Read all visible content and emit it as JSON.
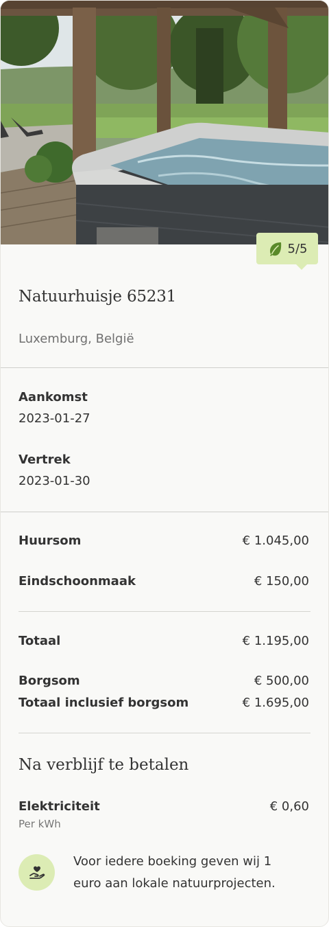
{
  "listing": {
    "eco_score": "5/5",
    "title": "Natuurhuisje 65231",
    "location": "Luxemburg, België"
  },
  "stay": {
    "arrival_label": "Aankomst",
    "arrival_date": "2023-01-27",
    "departure_label": "Vertrek",
    "departure_date": "2023-01-30"
  },
  "costs": {
    "rent_label": "Huursom",
    "rent_amount": "€ 1.045,00",
    "cleaning_label": "Eindschoonmaak",
    "cleaning_amount": "€ 150,00",
    "total_label": "Totaal",
    "total_amount": "€ 1.195,00",
    "deposit_label": "Borgsom",
    "deposit_amount": "€ 500,00",
    "total_incl_label": "Totaal inclusief borgsom",
    "total_incl_amount": "€ 1.695,00"
  },
  "after_stay": {
    "title": "Na verblijf te betalen",
    "electricity_label": "Elektriciteit",
    "electricity_amount": "€ 0,60",
    "electricity_unit": "Per kWh"
  },
  "charity": {
    "line1": "Voor iedere boeking geven wij 1",
    "line2": "euro aan lokale natuurprojecten."
  },
  "colors": {
    "accent_green": "#dcecb4",
    "leaf_green": "#5a8a2a"
  },
  "icons": {
    "eco": "leaf-icon",
    "charity": "hand-heart-icon"
  }
}
